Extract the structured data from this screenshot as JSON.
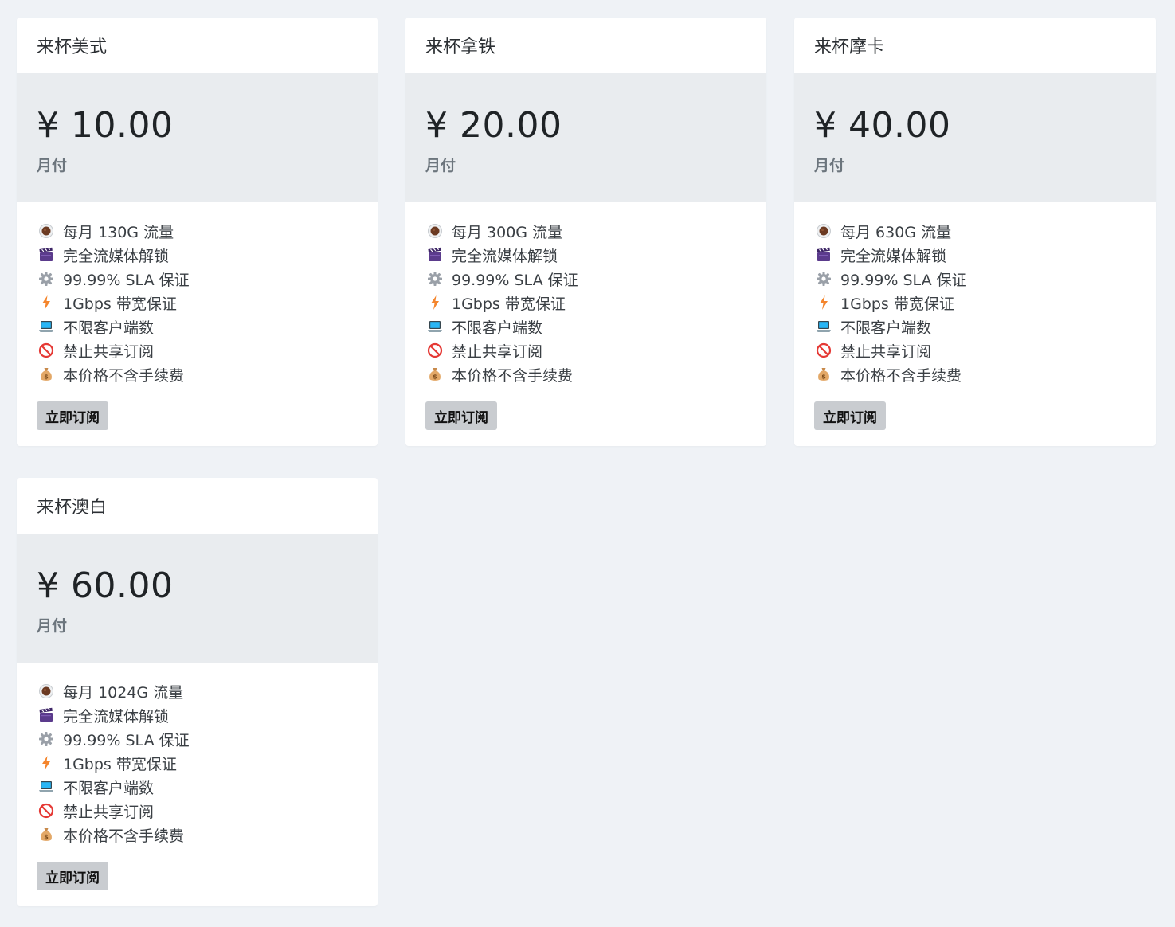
{
  "plans": [
    {
      "name": "来杯美式",
      "price": "¥ 10.00",
      "period": "月付",
      "features": [
        "每月 130G 流量",
        "完全流媒体解锁",
        "99.99% SLA 保证",
        "1Gbps 带宽保证",
        "不限客户端数",
        "禁止共享订阅",
        "本价格不含手续费"
      ],
      "button": "立即订阅"
    },
    {
      "name": "来杯拿铁",
      "price": "¥ 20.00",
      "period": "月付",
      "features": [
        "每月 300G 流量",
        "完全流媒体解锁",
        "99.99% SLA 保证",
        "1Gbps 带宽保证",
        "不限客户端数",
        "禁止共享订阅",
        "本价格不含手续费"
      ],
      "button": "立即订阅"
    },
    {
      "name": "来杯摩卡",
      "price": "¥ 40.00",
      "period": "月付",
      "features": [
        "每月 630G 流量",
        "完全流媒体解锁",
        "99.99% SLA 保证",
        "1Gbps 带宽保证",
        "不限客户端数",
        "禁止共享订阅",
        "本价格不含手续费"
      ],
      "button": "立即订阅"
    },
    {
      "name": "来杯澳白",
      "price": "¥ 60.00",
      "period": "月付",
      "features": [
        "每月 1024G 流量",
        "完全流媒体解锁",
        "99.99% SLA 保证",
        "1Gbps 带宽保证",
        "不限客户端数",
        "禁止共享订阅",
        "本价格不含手续费"
      ],
      "button": "立即订阅"
    }
  ],
  "feature_icons": [
    "coffee-icon",
    "clapper-board-icon",
    "gear-icon",
    "lightning-icon",
    "laptop-icon",
    "prohibited-icon",
    "money-bag-icon"
  ],
  "colors": {
    "page_background": "#eff2f6",
    "price_band": "#e9ecef",
    "button_background": "#c9ccd0",
    "muted_text": "#6c757d"
  }
}
